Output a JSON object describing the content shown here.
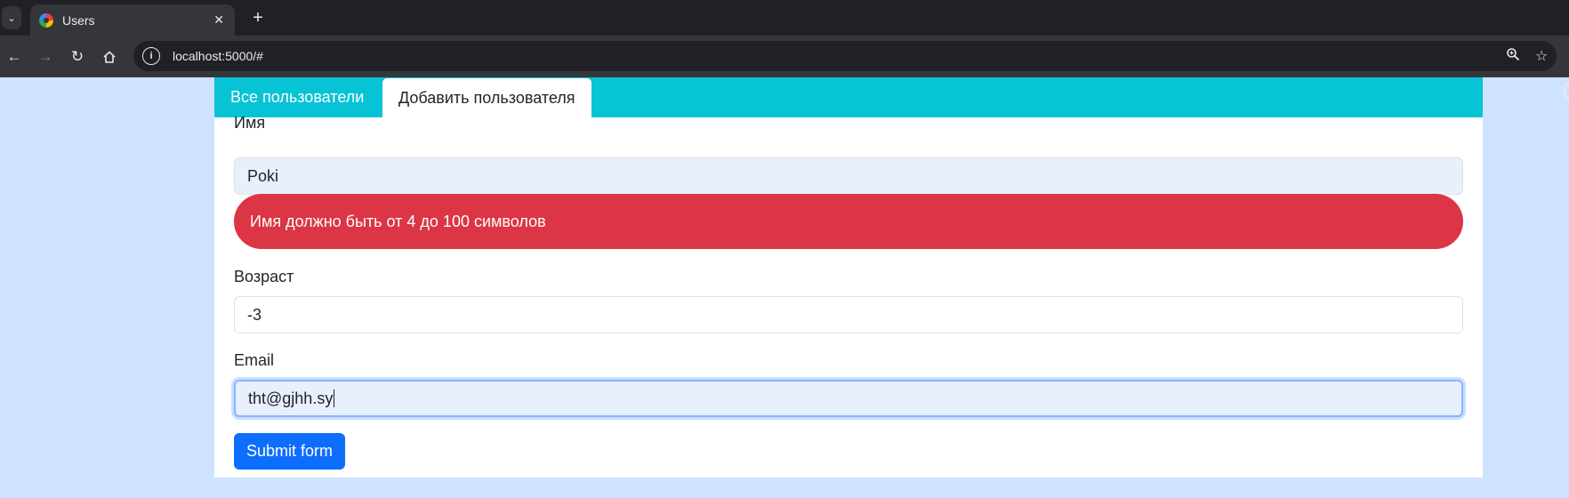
{
  "browser": {
    "tab_title": "Users",
    "close_glyph": "✕",
    "new_tab_glyph": "+",
    "menu_glyph": "⌄",
    "url": "localhost:5000/#",
    "icons": [
      "tab-search-icon",
      "back-arrow-icon",
      "forward-arrow-icon",
      "reload-icon",
      "home-icon",
      "site-info-icon",
      "zoom-icon",
      "bookmark-star-icon"
    ]
  },
  "nav": {
    "tab_all_users": "Все пользователи",
    "tab_add_user": "Добавить пользователя",
    "active_tab": "tab_add_user"
  },
  "form": {
    "name_label": "Имя",
    "name_value": "Poki",
    "name_error": "Имя должно быть от 4 до 100 символов",
    "age_label": "Возраст",
    "age_value": "-3",
    "email_label": "Email",
    "email_value": "tht@gjhh.sy",
    "submit_label": "Submit form"
  },
  "colors": {
    "page_background": "#cfe2ff",
    "tab_bar": "#06c3d6",
    "error": "#dc3545",
    "primary": "#0d6efd",
    "autofill": "#e8effd"
  }
}
